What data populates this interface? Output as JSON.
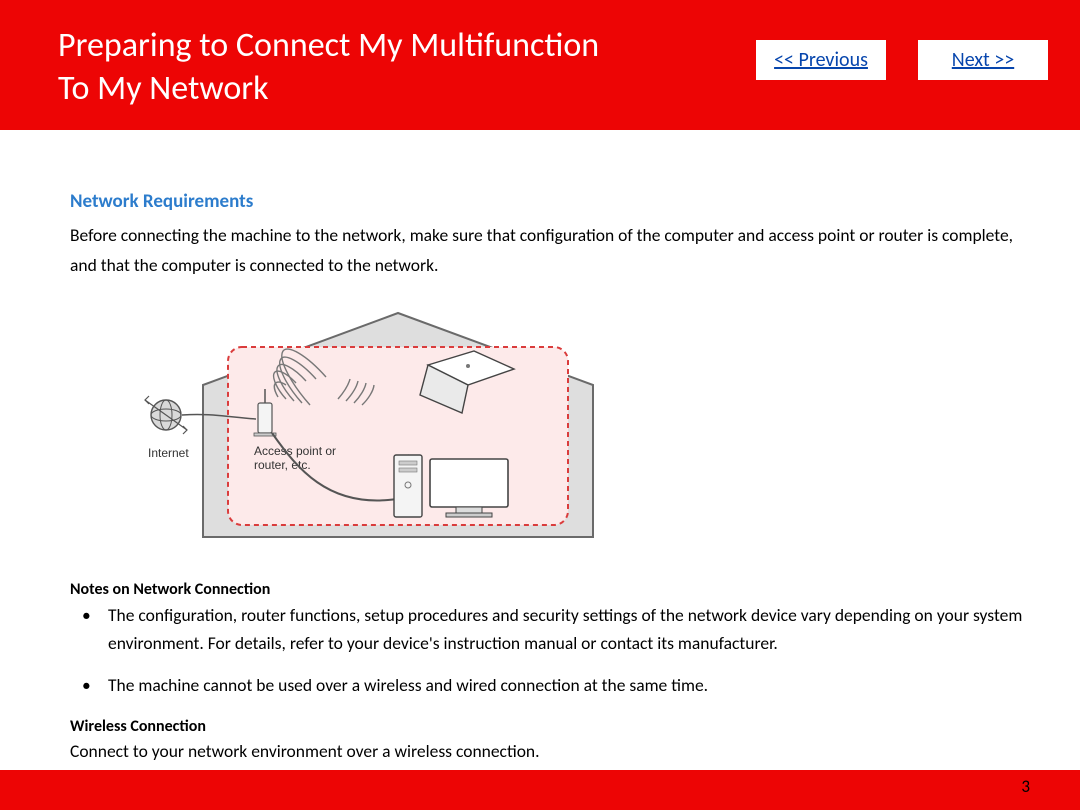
{
  "header": {
    "title_line1": "Preparing to Connect My Multifunction",
    "title_line2": "To My Network",
    "nav_prev": "<< Previous",
    "nav_next": "Next >>"
  },
  "content": {
    "section_heading": "Network Requirements",
    "intro": "Before connecting the machine to the network, make sure that configuration of the computer and access point or router is complete, and that the computer is connected to the network.",
    "notes_heading": "Notes on Network Connection",
    "bullets": {
      "b0": "The configuration, router functions, setup procedures and security settings of the network device vary depending on your system environment. For details, refer to your device's instruction manual or contact its manufacturer.",
      "b1": "The machine cannot be used over a wireless and wired connection at the same time."
    },
    "wireless_heading": "Wireless Connection",
    "wireless_text": "Connect to your network environment over a wireless connection.",
    "diagram": {
      "internet_label": "Internet",
      "ap_label_1": "Access point or",
      "ap_label_2": "router, etc."
    }
  },
  "page_number": "3"
}
